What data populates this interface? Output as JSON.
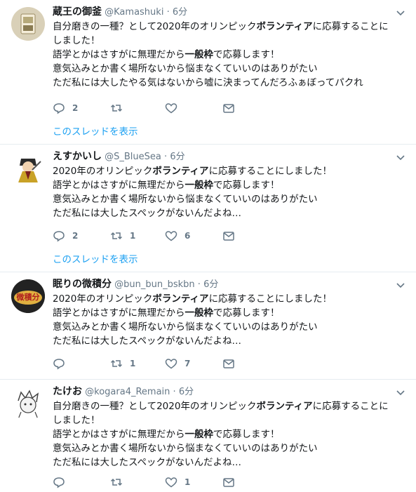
{
  "tweets": [
    {
      "name": "蔵王の御釜",
      "handle": "@Kamashuki",
      "time": "6分",
      "lines": [
        [
          "自分磨きの一種？として2020年のオリンピック",
          "ボランティア",
          "に応募することに"
        ],
        [
          "しました！",
          "",
          ""
        ],
        [
          "語学とかはさすがに無理だから",
          "一般枠",
          "で応募します！"
        ],
        [
          "意気込みとか書く場所ないから悩まなくていいのはありがたい",
          "",
          ""
        ],
        [
          "ただ私には大したやる気はないから嘘に決まってんだろふぁぼってパクれ",
          "",
          ""
        ]
      ],
      "replies": "2",
      "retweets": "",
      "likes": "",
      "thread": "このスレッドを表示"
    },
    {
      "name": "えすかいし",
      "handle": "@S_BlueSea",
      "time": "6分",
      "lines": [
        [
          "2020年のオリンピック",
          "ボランティア",
          "に応募することにしました！"
        ],
        [
          "語学とかはさすがに無理だから",
          "一般枠",
          "で応募します！"
        ],
        [
          "意気込みとか書く場所ないから悩まなくていいのはありがたい",
          "",
          ""
        ],
        [
          "ただ私には大したスペックがないんだよね…",
          "",
          ""
        ]
      ],
      "replies": "2",
      "retweets": "1",
      "likes": "6",
      "thread": "このスレッドを表示"
    },
    {
      "name": "眠りの微積分",
      "handle": "@bun_bun_bskbn",
      "time": "6分",
      "avatar_text": "微積分",
      "lines": [
        [
          "2020年のオリンピック",
          "ボランティア",
          "に応募することにしました！"
        ],
        [
          "語学とかはさすがに無理だから",
          "一般枠",
          "で応募します！"
        ],
        [
          "意気込みとか書く場所ないから悩まなくていいのはありがたい",
          "",
          ""
        ],
        [
          "ただ私には大したスペックがないんだよね…",
          "",
          ""
        ]
      ],
      "replies": "",
      "retweets": "1",
      "likes": "7",
      "thread": ""
    },
    {
      "name": "たけお",
      "handle": "@kogara4_Remain",
      "time": "6分",
      "lines": [
        [
          "自分磨きの一種？として2020年のオリンピック",
          "ボランティア",
          "に応募することに"
        ],
        [
          "しました！",
          "",
          ""
        ],
        [
          "語学とかはさすがに無理だから",
          "一般枠",
          "で応募します！"
        ],
        [
          "意気込みとか書く場所ないから悩まなくていいのはありがたい",
          "",
          ""
        ],
        [
          "ただ私には大したスペックがないんだよね…",
          "",
          ""
        ]
      ],
      "replies": "",
      "retweets": "",
      "likes": "1",
      "thread": ""
    }
  ],
  "icons": {
    "reply": "reply-icon",
    "retweet": "retweet-icon",
    "like": "heart-icon",
    "dm": "envelope-icon",
    "menu": "chevron-down-icon"
  },
  "colors": {
    "text": "#14171a",
    "secondary": "#657786",
    "link": "#1da1f2",
    "divider": "#e6ecf0"
  }
}
